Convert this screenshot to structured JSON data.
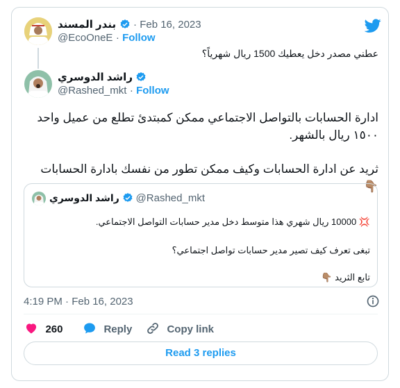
{
  "parent": {
    "name": "بندر المسند",
    "date": "Feb 16, 2023",
    "handle": "@EcoOneE",
    "follow": "Follow",
    "text": "عطني مصدر دخل يعطيك 1500 ريال شهرياً؟"
  },
  "tweet": {
    "name": "راشد الدوسري",
    "handle": "@Rashed_mkt",
    "follow": "Follow",
    "para1": "ادارة الحسابات بالتواصل الاجتماعي ممكن كمبتدئ تطلع من عميل واحد ١٥٠٠ ريال بالشهر.",
    "para2": "ثريد عن ادارة الحسابات وكيف ممكن تطور من نفسك بادارة الحسابات",
    "timestamp": "4:19 PM · Feb 16, 2023"
  },
  "quoted": {
    "name": "راشد الدوسري",
    "handle": "@Rashed_mkt",
    "line1": "10000 ريال شهري هذا متوسط دخل مدير حسابات التواصل الاجتماعي.",
    "line2": "تبغى تعرف كيف تصير مدير حسابات تواصل اجتماعي؟",
    "line3": "تابع الثريد"
  },
  "actions": {
    "likes": "260",
    "reply": "Reply",
    "copy_link": "Copy link"
  },
  "read_replies": "Read 3 replies",
  "colors": {
    "accent": "#1d9bf0",
    "like": "#f91880",
    "text": "#0f1419",
    "muted": "#536471"
  }
}
